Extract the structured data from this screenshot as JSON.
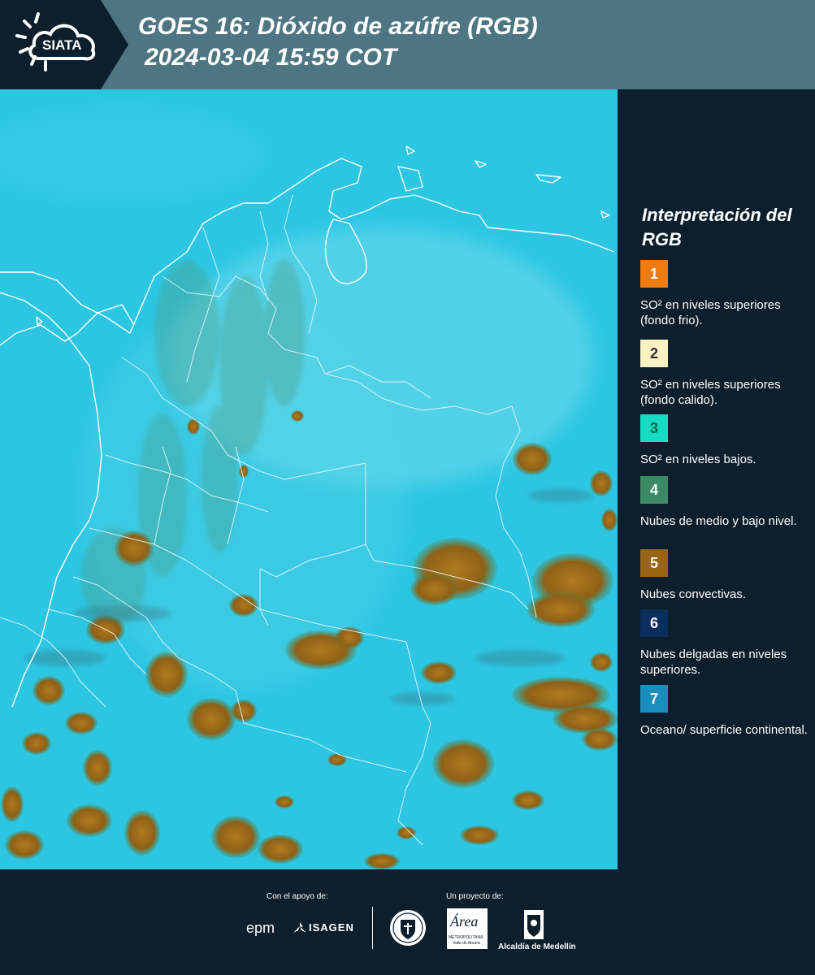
{
  "header": {
    "logo_text": "SIATA",
    "title_line1": "GOES 16: Dióxido de azúfre (RGB)",
    "title_line2": "2024-03-04 15:59 COT"
  },
  "legend": {
    "title": "Interpretación del RGB",
    "items": [
      {
        "number": "1",
        "color": "#f07c10",
        "text": "SO² en niveles superiores (fondo frio)."
      },
      {
        "number": "2",
        "color": "#fbf1c3",
        "text": "SO² en niveles superiores (fondo calido)."
      },
      {
        "number": "3",
        "color": "#14dcc0",
        "text": "SO² en niveles bajos."
      },
      {
        "number": "4",
        "color": "#3a8a66",
        "text": "Nubes de medio y bajo nivel."
      },
      {
        "number": "5",
        "color": "#9a6416",
        "text": "Nubes convectivas."
      },
      {
        "number": "6",
        "color": "#0c2e5e",
        "text": "Nubes delgadas en niveles superiores."
      },
      {
        "number": "7",
        "color": "#1a8fbd",
        "text": "Oceano/ superficie continental."
      }
    ]
  },
  "footer": {
    "support_label": "Con el apoyo de:",
    "project_label": "Un proyecto de:",
    "sponsor_epm": "epm",
    "sponsor_isagen": "ISAGEN",
    "area_logo_text": "Área",
    "area_subtext": "METROPOLITANA",
    "area_subtext2": "Valle de Aburrá",
    "alcaldia_text": "Alcaldía de Medellín"
  },
  "colors": {
    "header_bg": "#4e7682",
    "logo_bg": "#0d1f2c",
    "map_background": "#2cc6e3",
    "cloud_convective": "#9a6416",
    "border_lines": "#ffffff"
  }
}
